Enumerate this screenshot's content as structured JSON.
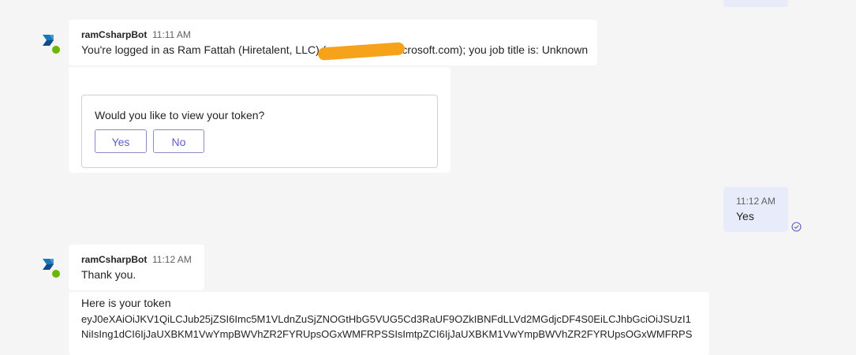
{
  "messages": [
    {
      "sender": "ramCsharpBot",
      "time": "11:11 AM",
      "text_before": "You're logged in as Ram Fattah (Hiretalent, LLC) (",
      "text_after": "icrosoft.com); you job title is: Unknown"
    },
    {
      "sender": "ramCsharpBot",
      "time": "11:12 AM",
      "text": "Thank you."
    }
  ],
  "card": {
    "question": "Would you like to view your token?",
    "yes_label": "Yes",
    "no_label": "No"
  },
  "user_reply": {
    "time": "11:12 AM",
    "text": "Yes"
  },
  "token_message": {
    "title": "Here is your token",
    "line1": "eyJ0eXAiOiJKV1QiLCJub25jZSI6Imc5M1VLdnZuSjZNOGtHbG5VUG5Cd3RaUF9OZkIBNFdLLVd2MGdjcDF4S0EiLCJhbGciOiJSUzI1",
    "line2": "NiIsIng1dCI6IjJaUXBKM1VwYmpBWVhZR2FYRUpsOGxWMFRPSSIsImtpZCI6IjJaUXBKM1VwYmpBWVhZR2FYRUpsOGxWMFRPS"
  },
  "colors": {
    "background": "#f5f5f5",
    "bubble_incoming": "#ffffff",
    "bubble_outgoing": "#e8ebfa",
    "accent": "#5b5fc7",
    "presence": "#6bb700",
    "redaction": "#f7a21b"
  }
}
